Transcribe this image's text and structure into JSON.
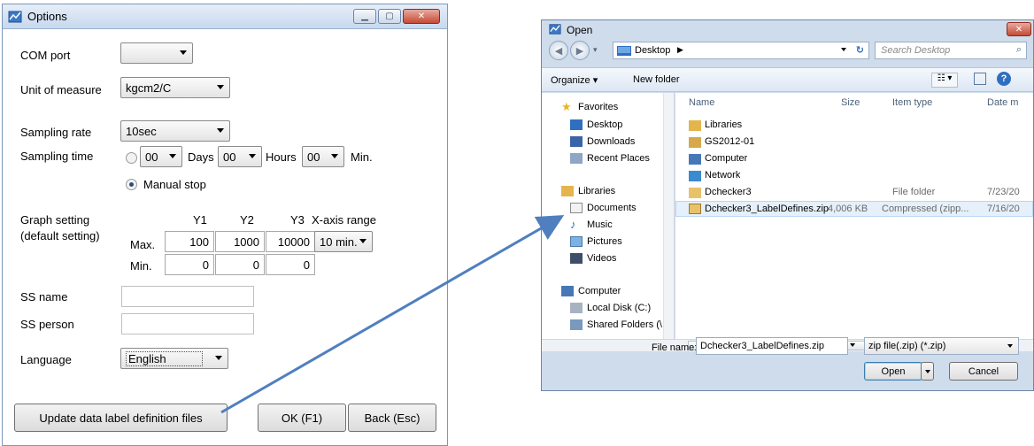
{
  "options": {
    "title": "Options",
    "com_port_label": "COM port",
    "com_port_value": "",
    "unit_label": "Unit of measure",
    "unit_value": "kgcm2/C",
    "sampling_rate_label": "Sampling rate",
    "sampling_rate_value": "10sec",
    "sampling_time_label": "Sampling time",
    "days_value": "00",
    "days_label": "Days",
    "hours_value": "00",
    "hours_label": "Hours",
    "min_value": "00",
    "min_label": "Min.",
    "manual_stop_label": "Manual stop",
    "graph_label_1": "Graph setting",
    "graph_label_2": "(default setting)",
    "col_y1": "Y1",
    "col_y2": "Y2",
    "col_y3": "Y3",
    "col_xrange": "X-axis range",
    "max_label": "Max.",
    "min_row_label": "Min.",
    "max_y1": "100",
    "max_y2": "1000",
    "max_y3": "10000",
    "min_y1": "0",
    "min_y2": "0",
    "min_y3": "0",
    "xrange_value": "10 min.",
    "ss_name_label": "SS name",
    "ss_person_label": "SS person",
    "language_label": "Language",
    "language_value": "English",
    "update_button": "Update data label definition files",
    "ok_button": "OK (F1)",
    "back_button": "Back (Esc)"
  },
  "open_dialog": {
    "title": "Open",
    "address": "Desktop",
    "search_placeholder": "Search Desktop",
    "organize": "Organize ▾",
    "new_folder": "New folder",
    "nav": {
      "favorites": "Favorites",
      "desktop": "Desktop",
      "downloads": "Downloads",
      "recent": "Recent Places",
      "libraries": "Libraries",
      "documents": "Documents",
      "music": "Music",
      "pictures": "Pictures",
      "videos": "Videos",
      "computer": "Computer",
      "local_disk": "Local Disk (C:)",
      "shared": "Shared Folders (\\"
    },
    "columns": {
      "name": "Name",
      "size": "Size",
      "type": "Item type",
      "date": "Date m"
    },
    "files": [
      {
        "name": "Libraries",
        "size": "",
        "type": "",
        "date": ""
      },
      {
        "name": "GS2012-01",
        "size": "",
        "type": "",
        "date": ""
      },
      {
        "name": "Computer",
        "size": "",
        "type": "",
        "date": ""
      },
      {
        "name": "Network",
        "size": "",
        "type": "",
        "date": ""
      },
      {
        "name": "Dchecker3",
        "size": "",
        "type": "File folder",
        "date": "7/23/20"
      },
      {
        "name": "Dchecker3_LabelDefines.zip",
        "size": "4,006 KB",
        "type": "Compressed (zipp...",
        "date": "7/16/20"
      }
    ],
    "scroll_mid": "III",
    "file_name_label": "File name:",
    "file_name_value": "Dchecker3_LabelDefines.zip",
    "file_type_value": "zip file(.zip) (*.zip)",
    "open_button": "Open",
    "cancel_button": "Cancel"
  },
  "colors": {
    "arrow": "#4f7fbf",
    "title_bar": "#c7d8ee",
    "selection": "#e5f0fb"
  }
}
